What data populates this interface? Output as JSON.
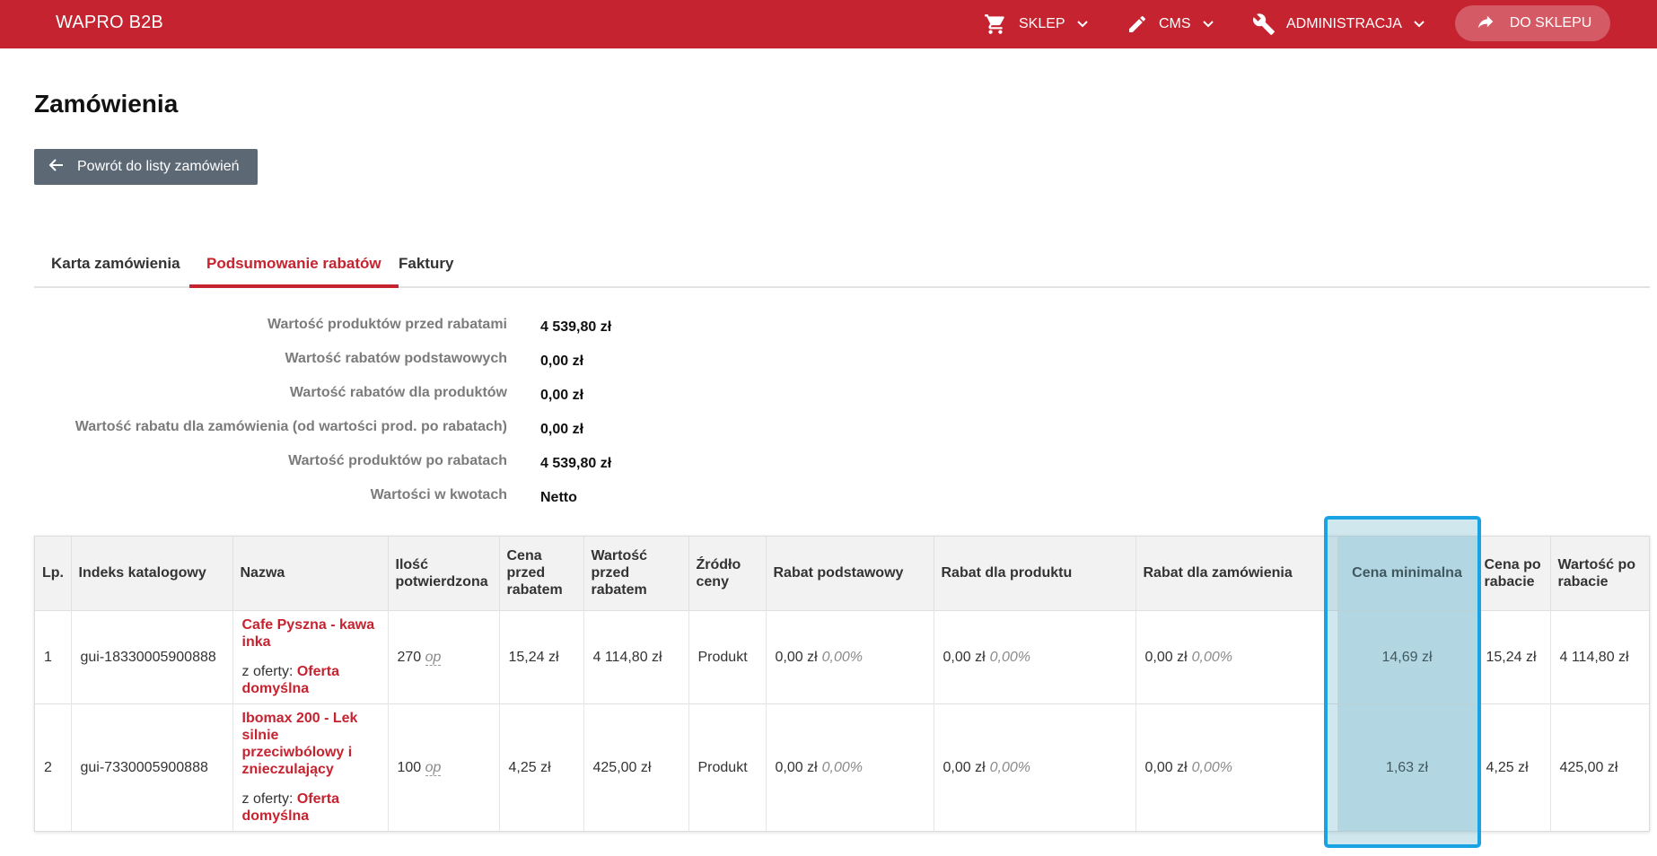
{
  "app": {
    "brand": "WAPRO B2B"
  },
  "nav": {
    "shop": "SKLEP",
    "cms": "CMS",
    "admin": "ADMINISTRACJA",
    "to_shop": "DO SKLEPU"
  },
  "page": {
    "title": "Zamówienia",
    "back_button": "Powrót do listy zamówień"
  },
  "tabs": [
    {
      "label": "Karta zamówienia",
      "active": false
    },
    {
      "label": "Podsumowanie rabatów",
      "active": true
    },
    {
      "label": "Faktury",
      "active": false
    }
  ],
  "summary": [
    {
      "label": "Wartość produktów przed rabatami",
      "value": "4 539,80 zł"
    },
    {
      "label": "Wartość rabatów podstawowych",
      "value": "0,00 zł"
    },
    {
      "label": "Wartość rabatów dla produktów",
      "value": "0,00 zł"
    },
    {
      "label": "Wartość rabatu dla zamówienia (od wartości prod. po rabatach)",
      "value": "0,00 zł"
    },
    {
      "label": "Wartość produktów po rabatach",
      "value": "4 539,80 zł"
    },
    {
      "label": "Wartości w kwotach",
      "value": "Netto"
    }
  ],
  "table": {
    "headers": {
      "lp": "Lp.",
      "index": "Indeks katalogowy",
      "name": "Nazwa",
      "qty": "Ilość potwierdzona",
      "price_before": "Cena przed rabatem",
      "value_before": "Wartość przed rabatem",
      "source": "Źródło ceny",
      "base_discount": "Rabat podstawowy",
      "product_discount": "Rabat dla produktu",
      "order_discount": "Rabat dla zamówienia",
      "min_price": "Cena minimalna",
      "price_after": "Cena po rabacie",
      "value_after": "Wartość po rabacie"
    },
    "offer_prefix": "z oferty:",
    "rows": [
      {
        "lp": "1",
        "index": "gui-18330005900888",
        "name": "Cafe Pyszna - kawa inka",
        "offer": "Oferta domyślna",
        "qty": "270",
        "unit": "op",
        "price_before": "15,24 zł",
        "value_before": "4 114,80 zł",
        "source": "Produkt",
        "base_discount": "0,00 zł",
        "base_discount_pct": "0,00%",
        "product_discount": "0,00 zł",
        "product_discount_pct": "0,00%",
        "order_discount": "0,00 zł",
        "order_discount_pct": "0,00%",
        "min_price": "14,69 zł",
        "price_after": "15,24 zł",
        "value_after": "4 114,80 zł"
      },
      {
        "lp": "2",
        "index": "gui-7330005900888",
        "name": "Ibomax 200 - Lek silnie przeciwbólowy i znieczulający",
        "offer": "Oferta domyślna",
        "qty": "100",
        "unit": "op",
        "price_before": "4,25 zł",
        "value_before": "425,00 zł",
        "source": "Produkt",
        "base_discount": "0,00 zł",
        "base_discount_pct": "0,00%",
        "product_discount": "0,00 zł",
        "product_discount_pct": "0,00%",
        "order_discount": "0,00 zł",
        "order_discount_pct": "0,00%",
        "min_price": "1,63 zł",
        "price_after": "4,25 zł",
        "value_after": "425,00 zł"
      }
    ]
  },
  "colors": {
    "brand_red": "#c52330",
    "button_gray": "#5c6874",
    "highlight_blue": "#1aa3e3"
  },
  "icons": {
    "shop": "cart-icon",
    "cms": "pencil-icon",
    "admin": "wrench-icon",
    "to_shop": "share-arrow-icon",
    "back": "arrow-left-icon"
  }
}
